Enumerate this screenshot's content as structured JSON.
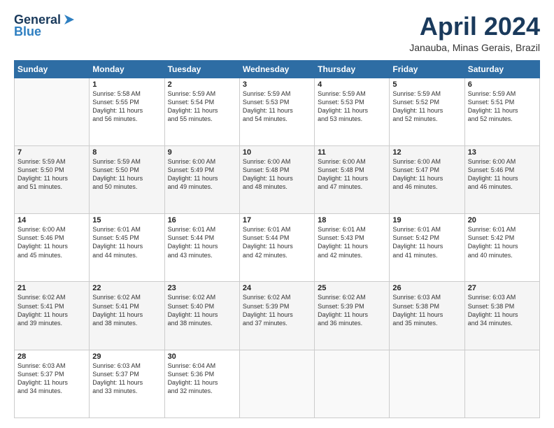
{
  "logo": {
    "general": "General",
    "blue": "Blue"
  },
  "title": "April 2024",
  "location": "Janauba, Minas Gerais, Brazil",
  "headers": [
    "Sunday",
    "Monday",
    "Tuesday",
    "Wednesday",
    "Thursday",
    "Friday",
    "Saturday"
  ],
  "weeks": [
    [
      {
        "day": "",
        "info": ""
      },
      {
        "day": "1",
        "info": "Sunrise: 5:58 AM\nSunset: 5:55 PM\nDaylight: 11 hours\nand 56 minutes."
      },
      {
        "day": "2",
        "info": "Sunrise: 5:59 AM\nSunset: 5:54 PM\nDaylight: 11 hours\nand 55 minutes."
      },
      {
        "day": "3",
        "info": "Sunrise: 5:59 AM\nSunset: 5:53 PM\nDaylight: 11 hours\nand 54 minutes."
      },
      {
        "day": "4",
        "info": "Sunrise: 5:59 AM\nSunset: 5:53 PM\nDaylight: 11 hours\nand 53 minutes."
      },
      {
        "day": "5",
        "info": "Sunrise: 5:59 AM\nSunset: 5:52 PM\nDaylight: 11 hours\nand 52 minutes."
      },
      {
        "day": "6",
        "info": "Sunrise: 5:59 AM\nSunset: 5:51 PM\nDaylight: 11 hours\nand 52 minutes."
      }
    ],
    [
      {
        "day": "7",
        "info": "Sunrise: 5:59 AM\nSunset: 5:50 PM\nDaylight: 11 hours\nand 51 minutes."
      },
      {
        "day": "8",
        "info": "Sunrise: 5:59 AM\nSunset: 5:50 PM\nDaylight: 11 hours\nand 50 minutes."
      },
      {
        "day": "9",
        "info": "Sunrise: 6:00 AM\nSunset: 5:49 PM\nDaylight: 11 hours\nand 49 minutes."
      },
      {
        "day": "10",
        "info": "Sunrise: 6:00 AM\nSunset: 5:48 PM\nDaylight: 11 hours\nand 48 minutes."
      },
      {
        "day": "11",
        "info": "Sunrise: 6:00 AM\nSunset: 5:48 PM\nDaylight: 11 hours\nand 47 minutes."
      },
      {
        "day": "12",
        "info": "Sunrise: 6:00 AM\nSunset: 5:47 PM\nDaylight: 11 hours\nand 46 minutes."
      },
      {
        "day": "13",
        "info": "Sunrise: 6:00 AM\nSunset: 5:46 PM\nDaylight: 11 hours\nand 46 minutes."
      }
    ],
    [
      {
        "day": "14",
        "info": "Sunrise: 6:00 AM\nSunset: 5:46 PM\nDaylight: 11 hours\nand 45 minutes."
      },
      {
        "day": "15",
        "info": "Sunrise: 6:01 AM\nSunset: 5:45 PM\nDaylight: 11 hours\nand 44 minutes."
      },
      {
        "day": "16",
        "info": "Sunrise: 6:01 AM\nSunset: 5:44 PM\nDaylight: 11 hours\nand 43 minutes."
      },
      {
        "day": "17",
        "info": "Sunrise: 6:01 AM\nSunset: 5:44 PM\nDaylight: 11 hours\nand 42 minutes."
      },
      {
        "day": "18",
        "info": "Sunrise: 6:01 AM\nSunset: 5:43 PM\nDaylight: 11 hours\nand 42 minutes."
      },
      {
        "day": "19",
        "info": "Sunrise: 6:01 AM\nSunset: 5:42 PM\nDaylight: 11 hours\nand 41 minutes."
      },
      {
        "day": "20",
        "info": "Sunrise: 6:01 AM\nSunset: 5:42 PM\nDaylight: 11 hours\nand 40 minutes."
      }
    ],
    [
      {
        "day": "21",
        "info": "Sunrise: 6:02 AM\nSunset: 5:41 PM\nDaylight: 11 hours\nand 39 minutes."
      },
      {
        "day": "22",
        "info": "Sunrise: 6:02 AM\nSunset: 5:41 PM\nDaylight: 11 hours\nand 38 minutes."
      },
      {
        "day": "23",
        "info": "Sunrise: 6:02 AM\nSunset: 5:40 PM\nDaylight: 11 hours\nand 38 minutes."
      },
      {
        "day": "24",
        "info": "Sunrise: 6:02 AM\nSunset: 5:39 PM\nDaylight: 11 hours\nand 37 minutes."
      },
      {
        "day": "25",
        "info": "Sunrise: 6:02 AM\nSunset: 5:39 PM\nDaylight: 11 hours\nand 36 minutes."
      },
      {
        "day": "26",
        "info": "Sunrise: 6:03 AM\nSunset: 5:38 PM\nDaylight: 11 hours\nand 35 minutes."
      },
      {
        "day": "27",
        "info": "Sunrise: 6:03 AM\nSunset: 5:38 PM\nDaylight: 11 hours\nand 34 minutes."
      }
    ],
    [
      {
        "day": "28",
        "info": "Sunrise: 6:03 AM\nSunset: 5:37 PM\nDaylight: 11 hours\nand 34 minutes."
      },
      {
        "day": "29",
        "info": "Sunrise: 6:03 AM\nSunset: 5:37 PM\nDaylight: 11 hours\nand 33 minutes."
      },
      {
        "day": "30",
        "info": "Sunrise: 6:04 AM\nSunset: 5:36 PM\nDaylight: 11 hours\nand 32 minutes."
      },
      {
        "day": "",
        "info": ""
      },
      {
        "day": "",
        "info": ""
      },
      {
        "day": "",
        "info": ""
      },
      {
        "day": "",
        "info": ""
      }
    ]
  ]
}
